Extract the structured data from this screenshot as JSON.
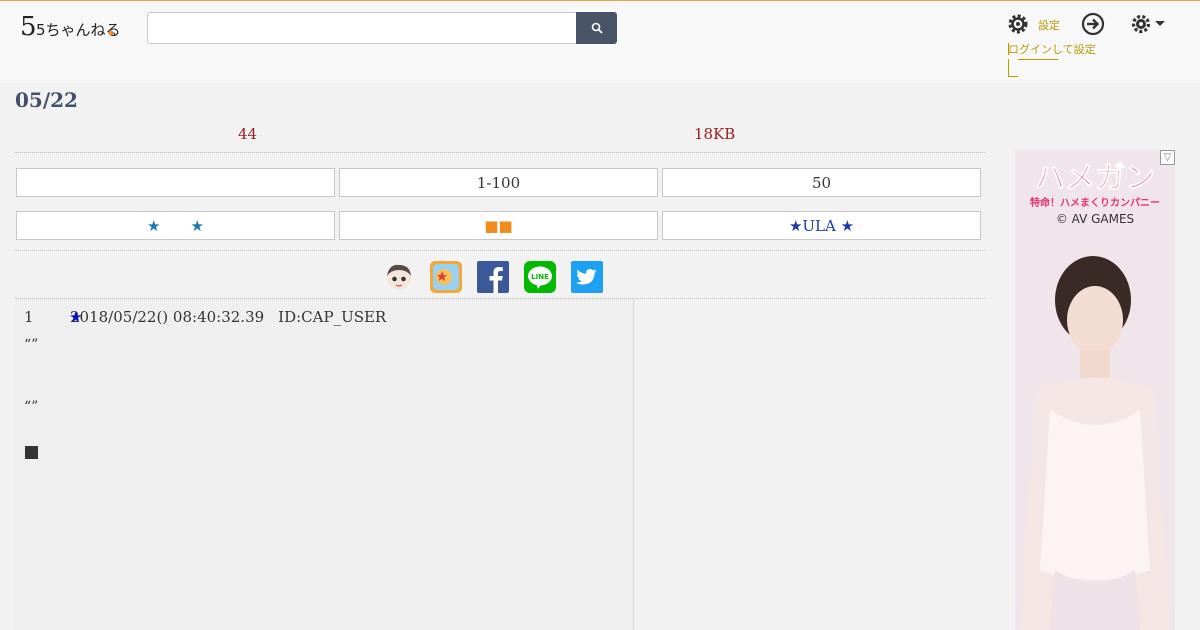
{
  "header": {
    "logo_text": "5ちゃんねる",
    "search_value": "",
    "search_placeholder": "",
    "settings_link_1": "設定",
    "settings_link_2": "ログインして設定"
  },
  "thread": {
    "date_title": "05/22",
    "post_count": "44",
    "size": "18KB"
  },
  "nav": {
    "row1": [
      "",
      "1-100",
      "50"
    ],
    "row2": [
      "★　　★",
      "■■",
      "★ULA ★"
    ]
  },
  "post": {
    "number": "1",
    "star": "★",
    "datetime": "2018/05/22() 08:40:32.39",
    "id": "ID:CAP_USER",
    "line1": "“”",
    "line2": "“”"
  },
  "ad": {
    "title": "ハメガン",
    "subtitle": "特命！ハメまくりカンパニー",
    "brand": "© AV GAMES",
    "badge": "▽"
  },
  "colors": {
    "accent_top": "#f0a040",
    "stat_red": "#9b1b1b",
    "link_gold": "#b79a00",
    "search_btn": "#4a5469",
    "star_blue": "#0010c8",
    "orange_square": "#f08b1e"
  }
}
